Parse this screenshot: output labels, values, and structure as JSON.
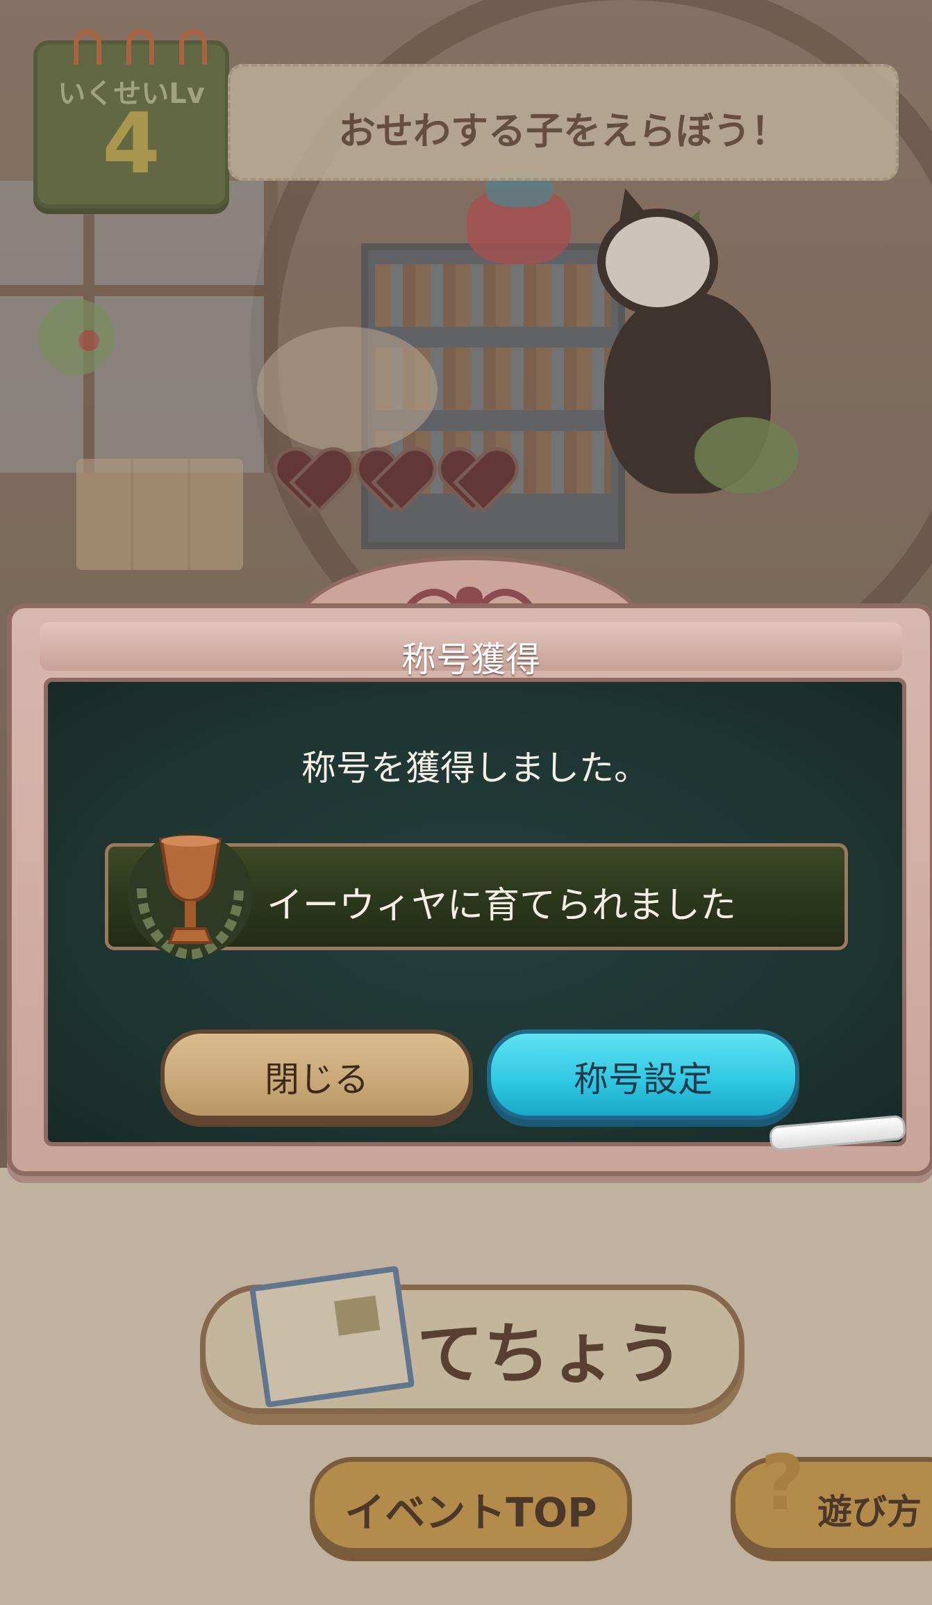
{
  "header": {
    "level_label": "いくせいLv",
    "level_value": "4",
    "banner_text": "おせわする子をえらぼう！"
  },
  "dialog": {
    "title": "称号獲得",
    "message": "称号を獲得しました。",
    "award_title": "イーウィヤに育てられました",
    "close_label": "閉じる",
    "settings_label": "称号設定"
  },
  "footer": {
    "notebook_label": "てちょう",
    "event_top_label": "イベントTOP",
    "howto_label": "遊び方",
    "howto_mark": "?"
  },
  "colors": {
    "dialog_board": "#1d3330",
    "settings_button": "#2fc6e2",
    "close_button": "#c9a878",
    "frame": "#c9a59a"
  },
  "icons": {
    "award": "bronze-trophy-icon",
    "notebook": "notebook-icon",
    "help": "question-mark-icon"
  }
}
